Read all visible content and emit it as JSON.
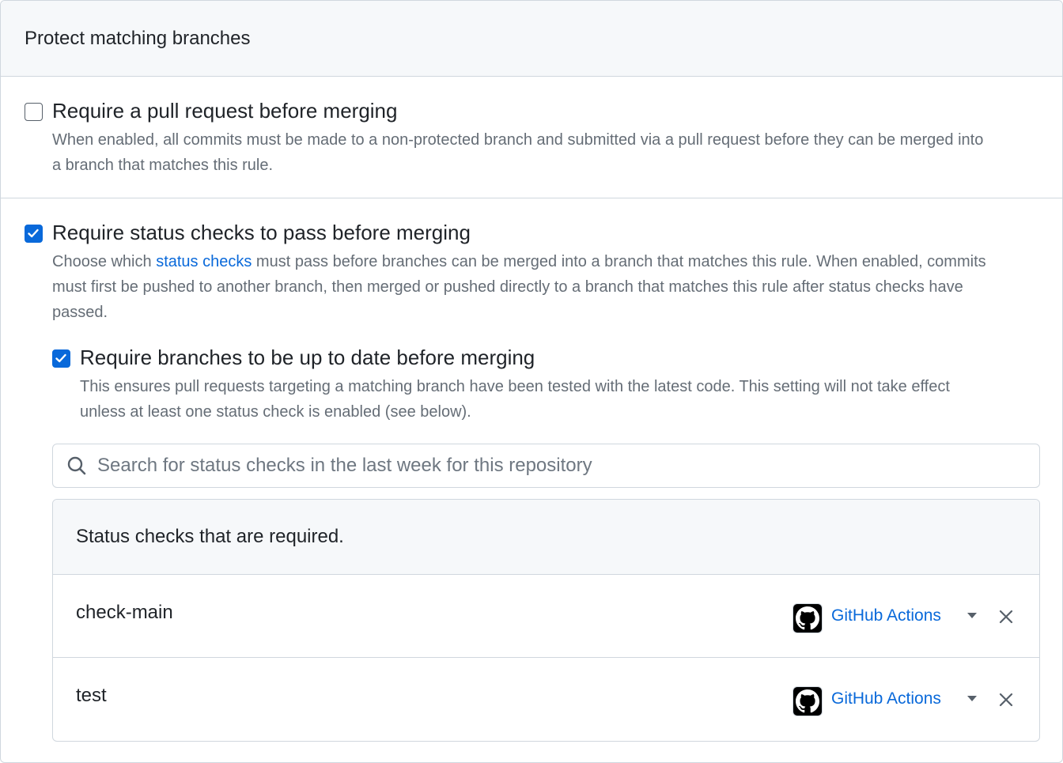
{
  "header": {
    "title": "Protect matching branches"
  },
  "require_pr": {
    "checked": false,
    "title": "Require a pull request before merging",
    "desc_line1": "When enabled, all commits must be made to a non-protected branch and submitted via a pull request before they can be merged into",
    "desc_line2": "a branch that matches this rule."
  },
  "require_status": {
    "checked": true,
    "title": "Require status checks to pass before merging",
    "desc_prefix": "Choose which ",
    "desc_link": "status checks",
    "desc_suffix_line1": " must pass before branches can be merged into a branch that matches this rule. When enabled, commits",
    "desc_line2": "must first be pushed to another branch, then merged or pushed directly to a branch that matches this rule after status checks have",
    "desc_line3": "passed."
  },
  "require_uptodate": {
    "checked": true,
    "title": "Require branches to be up to date before merging",
    "desc_line1": "This ensures pull requests targeting a matching branch have been tested with the latest code. This setting will not take effect",
    "desc_line2": "unless at least one status check is enabled (see below)."
  },
  "search": {
    "placeholder": "Search for status checks in the last week for this repository"
  },
  "checks": {
    "header": "Status checks that are required.",
    "items": [
      {
        "name": "check-main",
        "app": "GitHub Actions"
      },
      {
        "name": "test",
        "app": "GitHub Actions"
      }
    ]
  },
  "colors": {
    "accent": "#0969da",
    "muted": "#656d76",
    "border": "#d0d7de"
  }
}
